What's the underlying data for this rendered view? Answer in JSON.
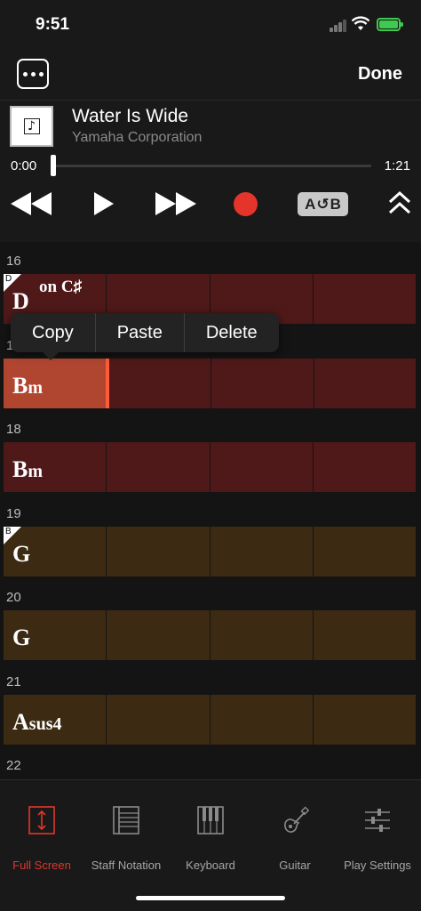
{
  "status": {
    "time": "9:51"
  },
  "header": {
    "more_icon": "ellipsis-icon",
    "done_label": "Done"
  },
  "song": {
    "title": "Water Is Wide",
    "artist": "Yamaha Corporation",
    "art_icon": "music-note-icon"
  },
  "playback": {
    "current_time": "0:00",
    "total_time": "1:21",
    "progress": 0.0,
    "ab_label_a": "A",
    "ab_label_b": "B"
  },
  "colors": {
    "accent": "#e5352a",
    "bar_red": "#4f1919",
    "bar_gold": "#3c2a12",
    "selected": "#b14630"
  },
  "bars": [
    {
      "number": "16",
      "chord_main": "D",
      "chord_suffix": "",
      "chord_on": "on C♯",
      "tag": "D",
      "color": "red"
    },
    {
      "number": "17",
      "chord_main": "B",
      "chord_suffix": "m",
      "chord_on": "",
      "tag": "",
      "color": "red",
      "selected": true
    },
    {
      "number": "18",
      "chord_main": "B",
      "chord_suffix": "m",
      "chord_on": "",
      "tag": "",
      "color": "red"
    },
    {
      "number": "19",
      "chord_main": "G",
      "chord_suffix": "",
      "chord_on": "",
      "tag": "B",
      "color": "gold"
    },
    {
      "number": "20",
      "chord_main": "G",
      "chord_suffix": "",
      "chord_on": "",
      "tag": "",
      "color": "gold"
    },
    {
      "number": "21",
      "chord_main": "A",
      "chord_suffix": "sus4",
      "chord_on": "",
      "tag": "",
      "color": "gold"
    },
    {
      "number": "22"
    }
  ],
  "context_menu": {
    "copy": "Copy",
    "paste": "Paste",
    "delete": "Delete"
  },
  "tabs": [
    {
      "label": "Full Screen",
      "icon": "full-screen-icon",
      "active": true
    },
    {
      "label": "Staff Notation",
      "icon": "staff-notation-icon"
    },
    {
      "label": "Keyboard",
      "icon": "keyboard-icon"
    },
    {
      "label": "Guitar",
      "icon": "guitar-icon"
    },
    {
      "label": "Play Settings",
      "icon": "sliders-icon"
    }
  ]
}
